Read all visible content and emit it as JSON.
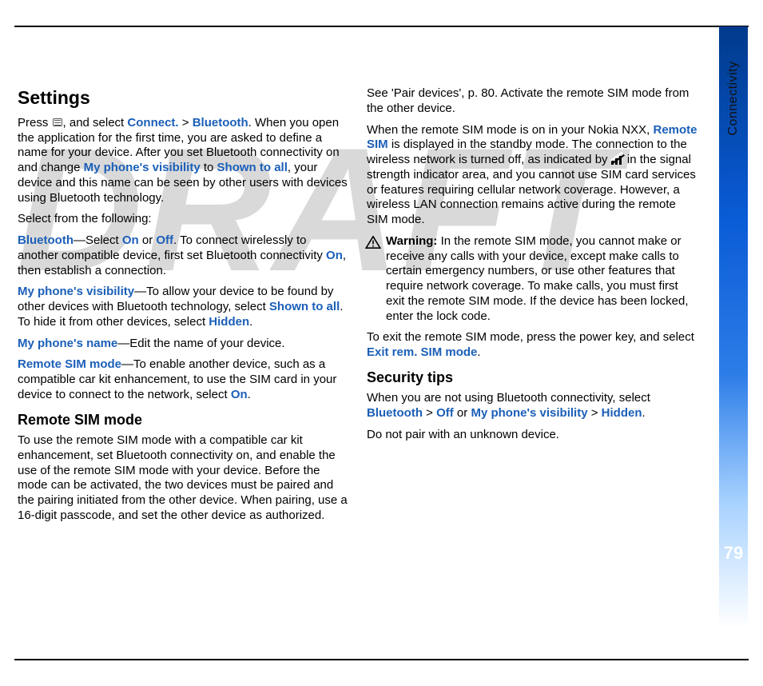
{
  "side": {
    "label": "Connectivity",
    "page": "79"
  },
  "watermark": "DRAFT",
  "h_settings": "Settings",
  "p_intro_a": "Press ",
  "p_intro_b": ", and select ",
  "kw_connect": "Connect.",
  "gt": " > ",
  "kw_bluetooth": "Bluetooth",
  "p_intro_c": ". When you open the application for the first time, you are asked to define a name for your device. After you set Bluetooth connectivity on and change ",
  "kw_vis": "My phone's visibility",
  "p_intro_d": " to ",
  "kw_shownall": "Shown to all",
  "p_intro_e": ", your device and this name can be seen by other users with devices using Bluetooth technology.",
  "p_select": "Select from the following:",
  "p_bt_a": "—Select ",
  "kw_on": "On",
  "p_or": " or ",
  "kw_off": "Off",
  "p_bt_b": ". To connect wirelessly to another compatible device, first set Bluetooth connectivity ",
  "p_bt_c": ", then establish a connection.",
  "p_vis_a": "—To allow your device to be found by other devices with Bluetooth technology, select ",
  "p_vis_b": ". To hide it from other devices, select ",
  "kw_hidden": "Hidden",
  "period": ".",
  "kw_name": "My phone's name",
  "p_name": "—Edit the name of your device.",
  "kw_rsim": "Remote SIM mode",
  "p_rsim_a": "—To enable another device, such as a compatible car kit enhancement, to use the SIM card in your device to connect to the network, select ",
  "h_rsim": "Remote SIM mode",
  "p_rsim2": "To use the remote SIM mode with a compatible car kit enhancement, set Bluetooth connectivity on, and enable the use of the remote SIM mode with your device. Before the mode can be activated, the two devices must be paired and the pairing initiated from the other device. When pairing, use a 16-digit passcode, and set the other device as authorized. See 'Pair devices', p. 80. Activate the remote SIM mode from the other device.",
  "p_rsim3_a": "When the remote SIM mode is on in your Nokia NXX, ",
  "kw_remotesim": "Remote SIM",
  "p_rsim3_b": " is displayed in the standby mode. The connection to the wireless network is turned off, as indicated by ",
  "p_rsim3_c": " in the signal strength indicator area, and you cannot use SIM card services or features requiring cellular network coverage. However, a wireless LAN connection remains active during the remote SIM mode.",
  "warn_lead": "Warning:",
  "warn_body": " In the remote SIM mode, you cannot make or receive any calls with your device, except make calls to certain emergency numbers, or use other features that require network coverage. To make calls, you must first exit the remote SIM mode. If the device has been locked, enter the lock code.",
  "p_exit_a": "To exit the remote SIM mode, press the power key, and select ",
  "kw_exit": "Exit rem. SIM mode",
  "h_sec": "Security tips",
  "p_sec_a": "When you are not using Bluetooth connectivity, select ",
  "p_sec_final": "Do not pair with an unknown device."
}
